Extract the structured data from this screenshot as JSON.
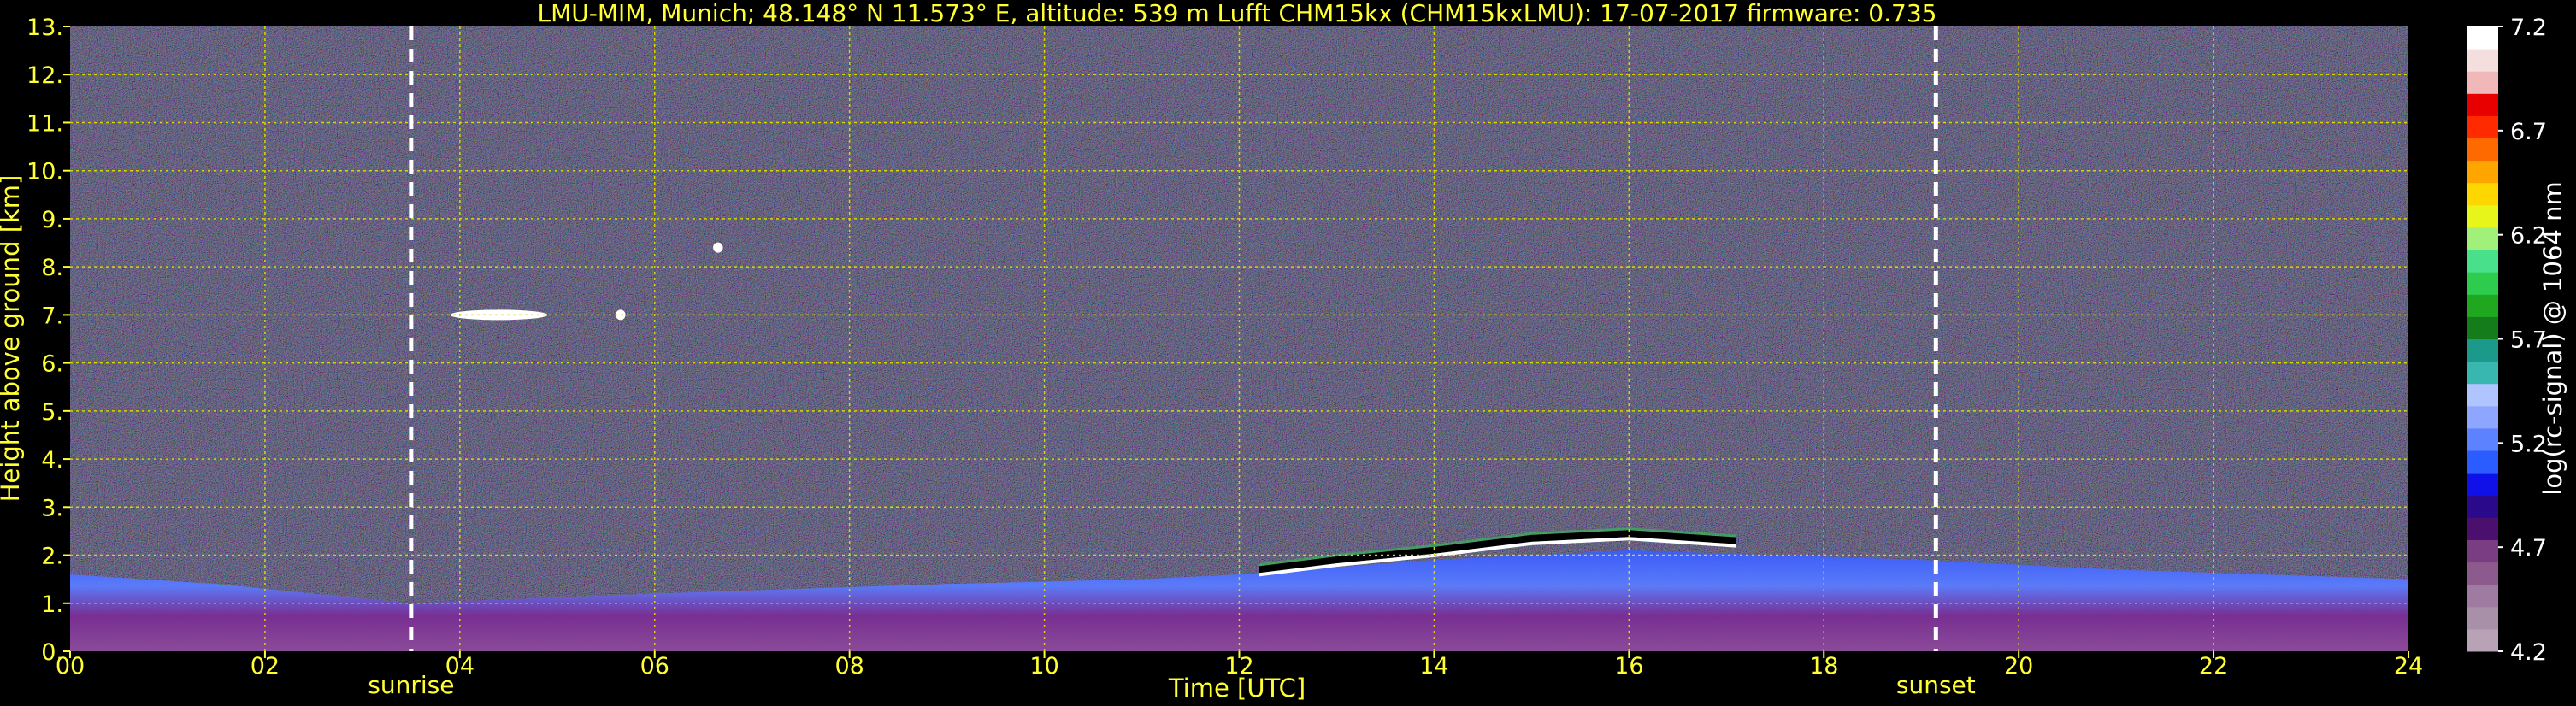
{
  "chart_data": {
    "type": "heatmap",
    "title": "LMU-MIM, Munich; 48.148° N 11.573° E, altitude: 539 m     Lufft CHM15kx (CHM15kxLMU): 17-07-2017     firmware: 0.735",
    "xlabel": "Time [UTC]",
    "ylabel": "Height above ground [km]",
    "xlim": [
      0,
      24
    ],
    "ylim": [
      0,
      13
    ],
    "x_ticks": [
      0,
      2,
      4,
      6,
      8,
      10,
      12,
      14,
      16,
      18,
      20,
      22,
      24
    ],
    "x_tick_labels": [
      "00",
      "02",
      "04",
      "06",
      "08",
      "10",
      "12",
      "14",
      "16",
      "18",
      "20",
      "22",
      "24"
    ],
    "y_ticks": [
      0,
      1,
      2,
      3,
      4,
      5,
      6,
      7,
      8,
      9,
      10,
      11,
      12,
      13
    ],
    "y_tick_labels": [
      "0.",
      "1.",
      "2.",
      "3.",
      "4.",
      "5.",
      "6.",
      "7.",
      "8.",
      "9.",
      "10.",
      "11.",
      "12.",
      "13."
    ],
    "grid": true,
    "events": [
      {
        "label": "sunrise",
        "time": 3.5
      },
      {
        "label": "sunset",
        "time": 19.15
      }
    ],
    "colorbar": {
      "label": "log(rc-signal) @ 1064 nm",
      "range": [
        4.2,
        7.2
      ],
      "ticks": [
        4.2,
        4.7,
        5.2,
        5.7,
        6.2,
        6.7,
        7.2
      ],
      "tick_labels": [
        "4.2",
        "4.7",
        "5.2",
        "5.7",
        "6.2",
        "6.7",
        "7.2"
      ],
      "colors": [
        "#b8a2b5",
        "#a790a8",
        "#a07ba1",
        "#8c5a8c",
        "#7a3c83",
        "#4b0f6e",
        "#2a0a8a",
        "#1010e8",
        "#2a5cff",
        "#5c82ff",
        "#8ea6ff",
        "#b0c4ff",
        "#38b7b0",
        "#1b9a8c",
        "#157c1c",
        "#1fa81f",
        "#2ecc4c",
        "#48e08a",
        "#a0f07a",
        "#e8f51a",
        "#ffd700",
        "#ffa500",
        "#ff6a00",
        "#ff2a00",
        "#e80000",
        "#f0b8b8",
        "#f5dede",
        "#ffffff"
      ]
    },
    "features": {
      "boundary_layer_top_km": [
        [
          0,
          1.6
        ],
        [
          1.5,
          1.4
        ],
        [
          3.5,
          1.0
        ],
        [
          6,
          1.2
        ],
        [
          9,
          1.4
        ],
        [
          11,
          1.5
        ],
        [
          12,
          1.6
        ],
        [
          14,
          1.9
        ],
        [
          16,
          2.1
        ],
        [
          17.5,
          2.0
        ],
        [
          19,
          1.9
        ],
        [
          21,
          1.7
        ],
        [
          24,
          1.5
        ]
      ],
      "cloud_layer_km": [
        [
          12.2,
          1.7
        ],
        [
          13,
          1.9
        ],
        [
          14,
          2.1
        ],
        [
          15,
          2.35
        ],
        [
          16,
          2.45
        ],
        [
          17.1,
          2.3
        ]
      ],
      "cirrus_patches": [
        {
          "t_start": 3.9,
          "t_end": 4.9,
          "height_km": 7.0
        },
        {
          "t_start": 5.6,
          "t_end": 5.7,
          "height_km": 7.0
        },
        {
          "t_start": 6.6,
          "t_end": 6.7,
          "height_km": 8.4
        }
      ]
    }
  }
}
